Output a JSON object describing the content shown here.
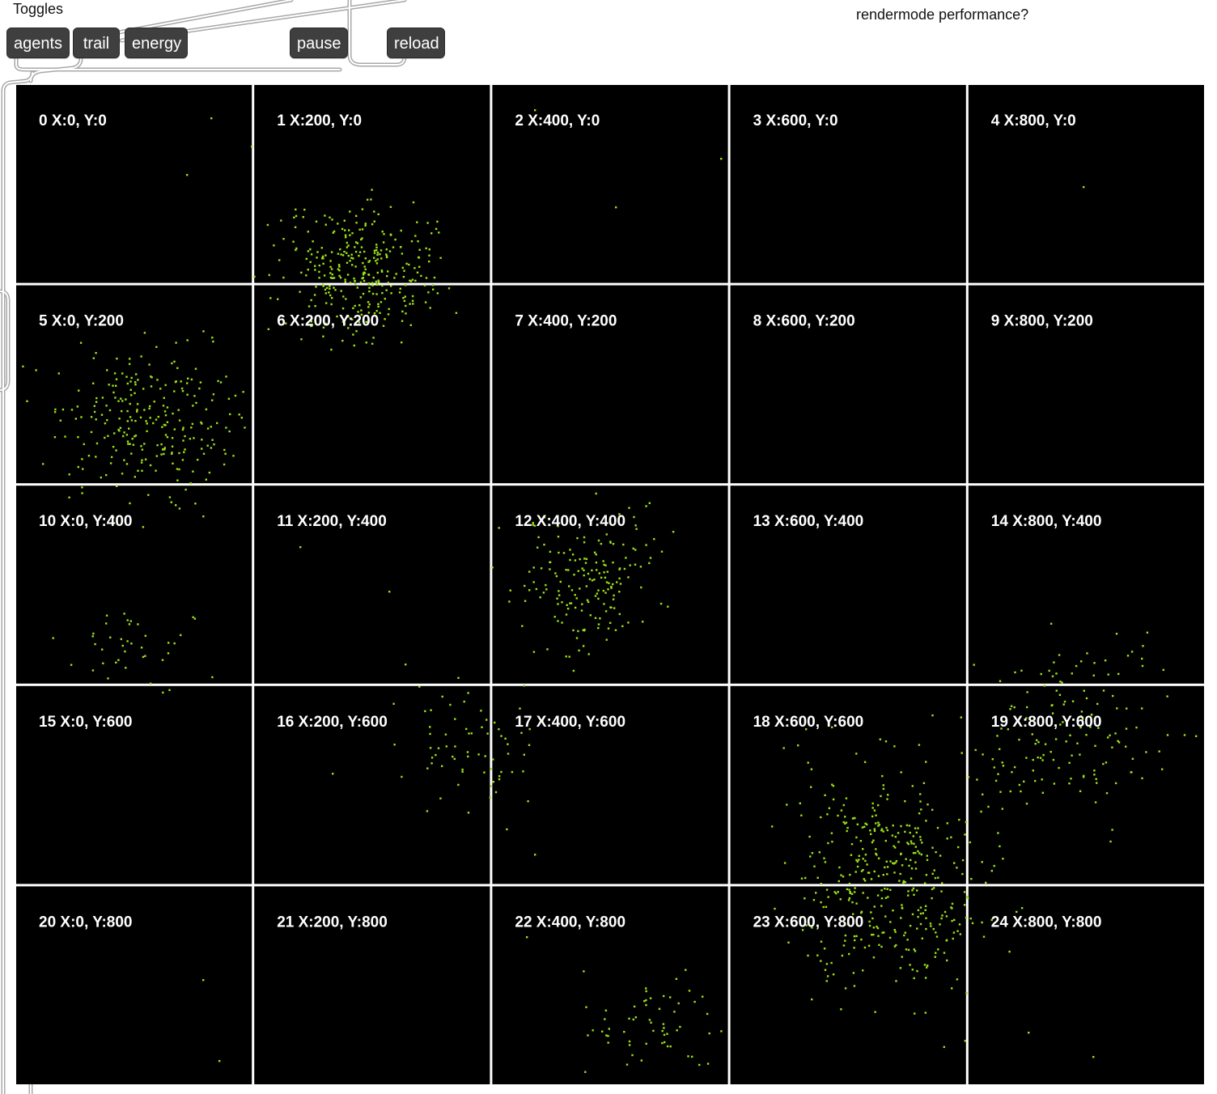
{
  "toggles_label": "Toggles",
  "perf_label": "rendermode performance?",
  "buttons": {
    "agents": "agents",
    "trail": "trail",
    "energy": "energy",
    "pause": "pause",
    "reload": "reload"
  },
  "colors": {
    "tile_background": "#000000",
    "grid_lines": "#ffffff",
    "agent_color": "#9be01a",
    "button_background": "#3f3f3f",
    "patch_cord": "#b3b3b3"
  },
  "grid": {
    "rows": 5,
    "cols": 5,
    "tiles": [
      {
        "label": "0 X:0, Y:0"
      },
      {
        "label": "1 X:200, Y:0"
      },
      {
        "label": "2 X:400, Y:0"
      },
      {
        "label": "3 X:600, Y:0"
      },
      {
        "label": "4 X:800, Y:0"
      },
      {
        "label": "5 X:0, Y:200"
      },
      {
        "label": "6 X:200, Y:200"
      },
      {
        "label": "7 X:400, Y:200"
      },
      {
        "label": "8 X:600, Y:200"
      },
      {
        "label": "9 X:800, Y:200"
      },
      {
        "label": "10 X:0, Y:400"
      },
      {
        "label": "11 X:200, Y:400"
      },
      {
        "label": "12 X:400, Y:400"
      },
      {
        "label": "13 X:600, Y:400"
      },
      {
        "label": "14 X:800, Y:400"
      },
      {
        "label": "15 X:0, Y:600"
      },
      {
        "label": "16 X:200, Y:600"
      },
      {
        "label": "17 X:400, Y:600"
      },
      {
        "label": "18 X:600, Y:600"
      },
      {
        "label": "19 X:800, Y:600"
      },
      {
        "label": "20 X:0, Y:800"
      },
      {
        "label": "21 X:200, Y:800"
      },
      {
        "label": "22 X:400, Y:800"
      },
      {
        "label": "23 X:600, Y:800"
      },
      {
        "label": "24 X:800, Y:800"
      }
    ]
  }
}
